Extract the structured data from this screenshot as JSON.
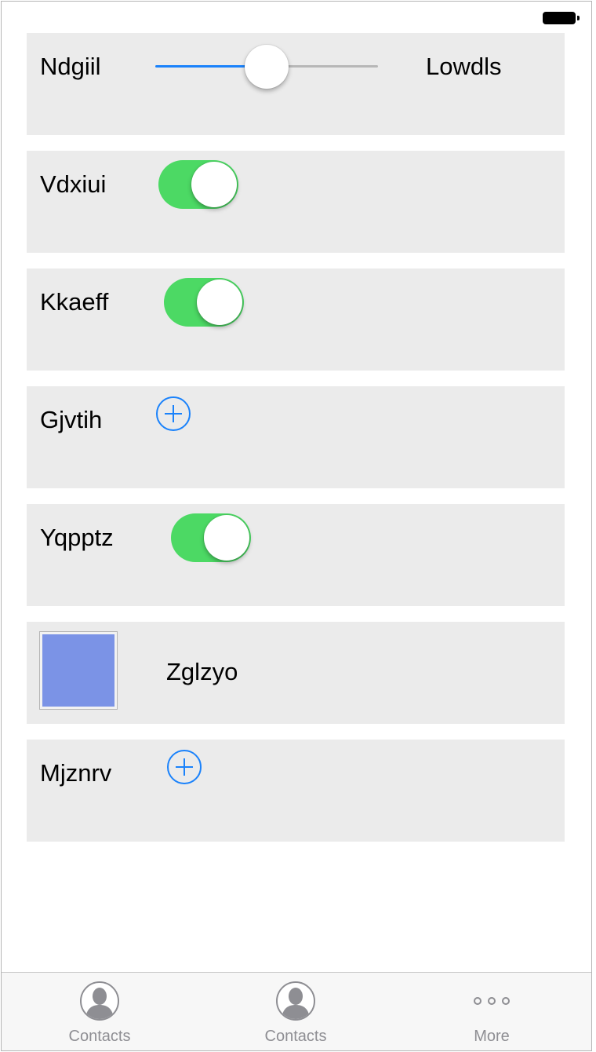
{
  "rows": {
    "slider_row": {
      "label": "Ndgiil",
      "max_label": "Lowdls",
      "value_fraction": 0.5
    },
    "toggle_row_1": {
      "label": "Vdxiui",
      "on": true
    },
    "toggle_row_2": {
      "label": "Kkaeff",
      "on": true
    },
    "add_row_1": {
      "label": "Gjvtih",
      "icon": "plus-circle-icon"
    },
    "toggle_row_3": {
      "label": "Yqpptz",
      "on": true
    },
    "swatch_row": {
      "label": "Zglzyo",
      "color": "#7b93e6"
    },
    "add_row_2": {
      "label": "Mjznrv",
      "icon": "plus-circle-icon"
    }
  },
  "tab_bar": {
    "tabs": [
      {
        "label": "Contacts",
        "icon": "contact-icon"
      },
      {
        "label": "Contacts",
        "icon": "contact-icon"
      },
      {
        "label": "More",
        "icon": "more-icon"
      }
    ]
  },
  "colors": {
    "accent": "#1a82fb",
    "toggle_on": "#4cd964",
    "row_background": "#ebebeb",
    "tab_label": "#8e8e93"
  }
}
